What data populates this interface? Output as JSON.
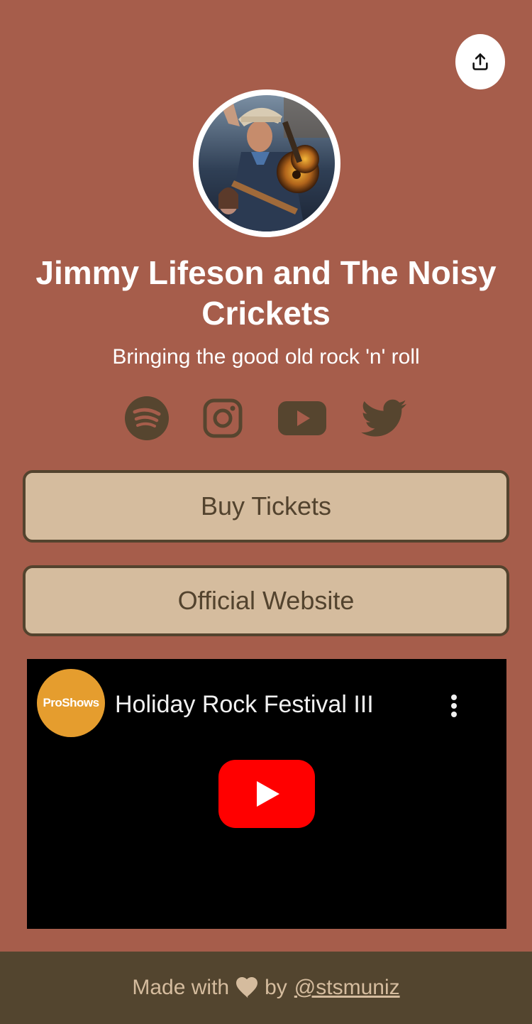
{
  "profile": {
    "name": "Jimmy Lifeson and The Noisy Crickets",
    "tagline": "Bringing the good old rock 'n' roll"
  },
  "share": {
    "icon": "share-upload-icon"
  },
  "social_links": [
    {
      "name": "Spotify",
      "icon": "spotify-icon"
    },
    {
      "name": "Instagram",
      "icon": "instagram-icon"
    },
    {
      "name": "YouTube",
      "icon": "youtube-icon"
    },
    {
      "name": "Twitter",
      "icon": "twitter-icon"
    }
  ],
  "links": {
    "buy_tickets": "Buy Tickets",
    "official_website": "Official Website"
  },
  "video": {
    "channel_logo_text": "ProShows",
    "title": "Holiday Rock Festival III",
    "play_icon": "youtube-play-icon"
  },
  "footer": {
    "made_with": "Made with",
    "by": "by",
    "author": "@stsmuniz"
  },
  "colors": {
    "background": "#a65d4b",
    "button_fill": "#d5bc9e",
    "button_border": "#53432e",
    "footer_bg": "#53452f",
    "icon_color": "#56452f",
    "youtube_red": "#ff0000",
    "channel_orange": "#e59d2e"
  }
}
